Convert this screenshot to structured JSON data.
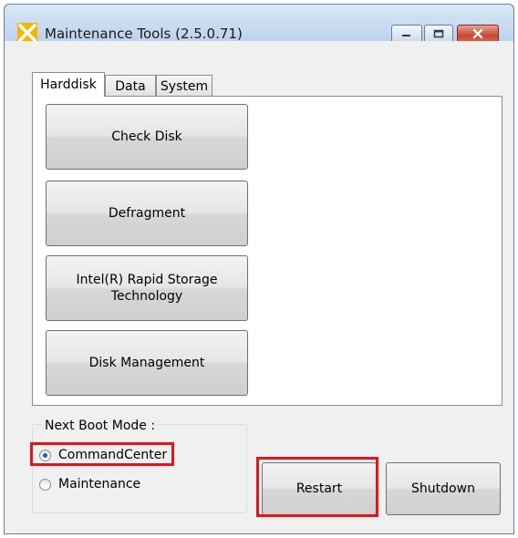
{
  "window": {
    "title": "Maintenance Tools (2.5.0.71)"
  },
  "title_buttons": {
    "minimize": "minimize-icon",
    "maximize": "maximize-icon",
    "close": "close-icon"
  },
  "tabs": [
    {
      "label": "Harddisk",
      "active": true
    },
    {
      "label": "Data",
      "active": false
    },
    {
      "label": "System",
      "active": false
    }
  ],
  "harddisk": {
    "buttons": [
      {
        "label": "Check Disk"
      },
      {
        "label": "Defragment"
      },
      {
        "label": "Intel(R) Rapid Storage Technology"
      },
      {
        "label": "Disk Management"
      }
    ]
  },
  "boot_mode": {
    "label": "Next Boot Mode :",
    "options": [
      {
        "label": "CommandCenter",
        "selected": true
      },
      {
        "label": "Maintenance",
        "selected": false
      }
    ]
  },
  "actions": {
    "restart": "Restart",
    "shutdown": "Shutdown"
  },
  "colors": {
    "highlight": "#e8131b",
    "titlebar": "#c2d6ee",
    "close_button": "#c94a31"
  }
}
